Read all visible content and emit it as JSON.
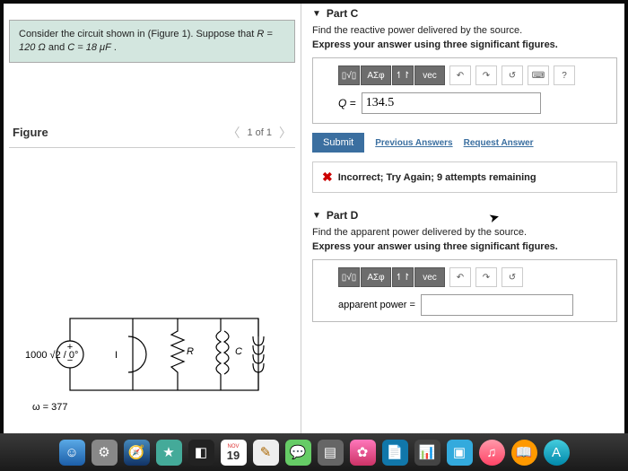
{
  "problem": {
    "intro_1": "Consider the circuit shown in (Figure 1). Suppose that ",
    "given_R": "R = 120 Ω",
    "and": " and ",
    "given_C": "C = 18 μF",
    "end": "."
  },
  "figure": {
    "title": "Figure",
    "nav": "1 of 1"
  },
  "circuit": {
    "source": "1000 √2 / 0°",
    "i": "I",
    "r": "R",
    "c": "C",
    "omega": "ω = 377"
  },
  "partC": {
    "title": "Part C",
    "q1": "Find the reactive power delivered by the source.",
    "q2": "Express your answer using three significant figures.",
    "tb": {
      "tmpl": "▯√▯",
      "sigma": "ΑΣφ",
      "arrows": "↿↾",
      "vec": "vec",
      "undo": "↶",
      "redo": "↷",
      "reset": "↺",
      "kbd": "⌨",
      "help": "?"
    },
    "var": "Q =",
    "value": "134.5",
    "submit": "Submit",
    "prev": "Previous Answers",
    "req": "Request Answer",
    "fb": "Incorrect; Try Again; 9 attempts remaining"
  },
  "partD": {
    "title": "Part D",
    "q1": "Find the apparent power delivered by the source.",
    "q2": "Express your answer using three significant figures.",
    "var": "apparent power ="
  },
  "dock": {
    "cal_month": "NOV",
    "cal_day": "19"
  }
}
